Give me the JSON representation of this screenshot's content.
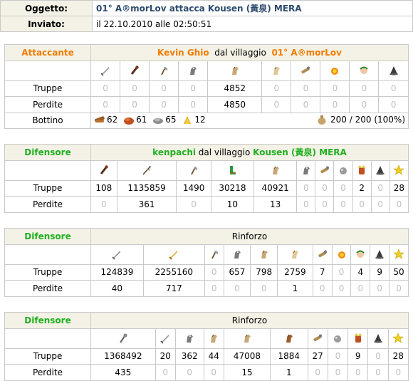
{
  "header": {
    "subject_label": "Oggetto:",
    "subject": "01° A®morLov attacca Kousen (黃泉) MERA",
    "sent_label": "Inviato:",
    "sent": "il 22.10.2010 alle 02:50:51"
  },
  "attacker": {
    "role": "Attaccante",
    "player": "Kevin Ghio",
    "from_text": "dal villaggio",
    "village": "01° A®morLov",
    "icons": [
      "sword-icon",
      "club-icon",
      "axe-icon",
      "scout-horse-icon",
      "horse-icon",
      "horse-light-icon",
      "ram-icon",
      "fire-icon",
      "senator-icon",
      "settler-icon"
    ],
    "troops_label": "Truppe",
    "troops": [
      0,
      0,
      0,
      0,
      4852,
      0,
      0,
      0,
      0,
      0
    ],
    "losses_label": "Perdite",
    "losses": [
      0,
      0,
      0,
      0,
      4850,
      0,
      0,
      0,
      0,
      0
    ],
    "loot_label": "Bottino",
    "loot": {
      "wood": "62",
      "clay": "61",
      "iron": "65",
      "crop": "12",
      "carry": "200 / 200 (100%)"
    }
  },
  "defender1": {
    "role": "Difensore",
    "player": "kenpachi",
    "from_text": "dal villaggio",
    "village": "Kousen (黃泉) MERA",
    "icons": [
      "club-icon",
      "spear-icon",
      "axe-icon",
      "boot-icon",
      "horse-icon",
      "scout-horse-icon",
      "ram-icon",
      "catapult-icon",
      "chief-icon",
      "settler-icon",
      "hero-icon"
    ],
    "troops_label": "Truppe",
    "troops": [
      "108",
      "1135859",
      "1490",
      "30218",
      "40921",
      "0",
      "0",
      "0",
      "2",
      "0",
      "28"
    ],
    "losses_label": "Perdite",
    "losses": [
      "0",
      "361",
      "0",
      "10",
      "13",
      "0",
      "0",
      "0",
      "0",
      "0",
      "0"
    ]
  },
  "defender2": {
    "role": "Difensore",
    "title": "Rinforzo",
    "icons": [
      "sword-icon",
      "sword-gold-icon",
      "axe-icon",
      "scout-horse-icon",
      "horse-icon",
      "horse-light-icon",
      "ram-icon",
      "fire-icon",
      "senator-icon",
      "settler-icon",
      "hero-icon"
    ],
    "troops_label": "Truppe",
    "troops": [
      "124839",
      "2255160",
      "0",
      "657",
      "798",
      "2759",
      "7",
      "0",
      "4",
      "9",
      "50"
    ],
    "losses_label": "Perdite",
    "losses": [
      "40",
      "717",
      "0",
      "0",
      "0",
      "1",
      "0",
      "0",
      "0",
      "0",
      "0"
    ]
  },
  "defender3": {
    "role": "Difensore",
    "title": "Rinforzo",
    "icons": [
      "mace-icon",
      "sword-icon",
      "scout-horse-icon",
      "horse-icon",
      "horse-icon",
      "horse-dark-icon",
      "ram-icon",
      "catapult-icon",
      "chief-icon",
      "settler-icon",
      "hero-icon"
    ],
    "troops_label": "Truppe",
    "troops": [
      "1368492",
      "20",
      "362",
      "44",
      "47008",
      "1884",
      "27",
      "0",
      "9",
      "0",
      "28"
    ],
    "losses_label": "Perdite",
    "losses": [
      "435",
      "0",
      "0",
      "0",
      "15",
      "1",
      "0",
      "0",
      "0",
      "0",
      "0"
    ]
  }
}
